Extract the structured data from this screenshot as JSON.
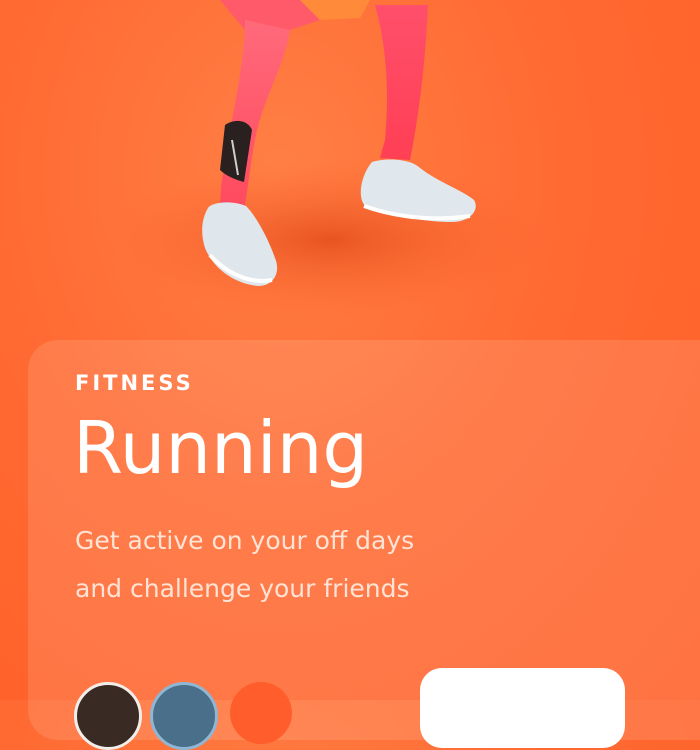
{
  "hero": {
    "image": "runner-legs-image"
  },
  "card": {
    "category": "FITNESS",
    "title": "Running",
    "description": "Get active on your off days and challenge your friends"
  },
  "friends": {
    "avatars": [
      "avatar-1",
      "avatar-2",
      "avatar-3"
    ]
  },
  "colors": {
    "background": "#ff6b33",
    "card": "rgba(255,255,255,0.12)",
    "text": "#ffffff",
    "subtext": "#ffe3d4",
    "button": "#ffffff"
  }
}
